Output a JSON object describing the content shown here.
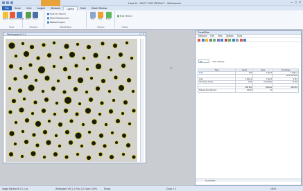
{
  "window": {
    "title": "Heat M - FACT FOR RESULT - Workbench",
    "btn_min": "–",
    "btn_max": "□",
    "btn_close": "×"
  },
  "tabs": [
    "File",
    "Home",
    "View",
    "Acquire",
    "Measure",
    "Layout",
    "Tools",
    "Share Window"
  ],
  "ribbon": {
    "groups": [
      {
        "label": "Tools"
      },
      {
        "label": "Measure"
      },
      {
        "label": "Classification"
      },
      {
        "label": "Options"
      },
      {
        "label": "Output"
      }
    ],
    "buttons": [
      "Select",
      "Measure",
      "Threshold",
      "Refine",
      "Count",
      "Table",
      "Data",
      "Export"
    ],
    "small": [
      "Optimize Objects",
      "Object Measurement",
      "Measure Layout",
      "Data Options"
    ]
  },
  "image_window": {
    "title": "Workspace M 1.1",
    "btns": "– □ ×"
  },
  "panel": {
    "title": "Count/Size",
    "menu": [
      "Measure",
      "Edit",
      "View",
      "Options",
      "Tools"
    ],
    "measure_value": "All",
    "measure_label": "Auto Classify",
    "bottom_tab": "Count/Size",
    "table": {
      "headers": [
        "Type",
        "Count",
        "Area",
        "% of Area"
      ],
      "rows": [
        [
          "Total",
          "761",
          "1.1E+5",
          "1.14E+2"
        ],
        [
          "",
          "",
          "",
          "26.5 px/count"
        ],
        [
          "Area",
          "1.11E+2",
          "1.1E+5",
          "0.112"
        ],
        [
          "Circularity (Cust)",
          "0.81",
          "Circularity",
          "71.0%"
        ],
        [
          "",
          "",
          "",
          ""
        ],
        [
          "",
          "186.261",
          "Objects",
          "186.261"
        ],
        [
          "Filtered Area Percent",
          "89.97",
          "%",
          ""
        ]
      ]
    }
  },
  "status": {
    "left": "Image Window W 1.1  1 px",
    "mid": "Workspace: WS 1.1  Pan: 1.0  Zoom: 100%",
    "mid2": "Ready",
    "right": "Zoom: 1:1",
    "far": "100%"
  },
  "particles": [
    [
      9,
      10,
      4.5
    ],
    [
      25,
      7,
      2
    ],
    [
      38,
      12,
      3
    ],
    [
      55,
      9,
      2.5
    ],
    [
      70,
      6,
      2
    ],
    [
      88,
      11,
      3.5
    ],
    [
      104,
      8,
      2
    ],
    [
      120,
      12,
      3
    ],
    [
      140,
      7,
      2.5
    ],
    [
      158,
      10,
      3
    ],
    [
      175,
      6,
      2
    ],
    [
      15,
      25,
      2
    ],
    [
      30,
      22,
      4
    ],
    [
      47,
      28,
      2.5
    ],
    [
      63,
      24,
      3
    ],
    [
      80,
      27,
      2
    ],
    [
      96,
      23,
      4
    ],
    [
      113,
      28,
      2
    ],
    [
      130,
      24,
      3.5
    ],
    [
      149,
      27,
      2
    ],
    [
      166,
      23,
      3
    ],
    [
      182,
      28,
      2
    ],
    [
      8,
      40,
      3
    ],
    [
      22,
      43,
      2
    ],
    [
      36,
      38,
      2.5
    ],
    [
      52,
      45,
      5
    ],
    [
      70,
      40,
      2
    ],
    [
      86,
      44,
      3
    ],
    [
      102,
      39,
      2.5
    ],
    [
      118,
      44,
      2
    ],
    [
      134,
      40,
      4
    ],
    [
      152,
      45,
      2
    ],
    [
      170,
      39,
      3
    ],
    [
      14,
      58,
      2.5
    ],
    [
      29,
      55,
      3
    ],
    [
      44,
      60,
      2
    ],
    [
      60,
      57,
      3.5
    ],
    [
      76,
      61,
      2
    ],
    [
      92,
      56,
      2.5
    ],
    [
      108,
      60,
      4
    ],
    [
      124,
      57,
      2
    ],
    [
      141,
      61,
      3
    ],
    [
      159,
      56,
      2.5
    ],
    [
      178,
      60,
      3
    ],
    [
      6,
      72,
      2
    ],
    [
      21,
      75,
      3
    ],
    [
      37,
      71,
      4.5
    ],
    [
      54,
      76,
      2
    ],
    [
      69,
      72,
      3
    ],
    [
      85,
      77,
      2.5
    ],
    [
      101,
      73,
      3
    ],
    [
      117,
      77,
      2
    ],
    [
      133,
      72,
      3
    ],
    [
      150,
      76,
      2
    ],
    [
      167,
      71,
      4
    ],
    [
      184,
      76,
      2
    ],
    [
      12,
      90,
      3
    ],
    [
      27,
      87,
      2
    ],
    [
      43,
      92,
      2.5
    ],
    [
      59,
      88,
      3
    ],
    [
      74,
      93,
      2
    ],
    [
      90,
      89,
      5
    ],
    [
      107,
      94,
      2
    ],
    [
      123,
      88,
      3
    ],
    [
      139,
      93,
      2.5
    ],
    [
      156,
      89,
      2
    ],
    [
      173,
      92,
      3
    ],
    [
      7,
      106,
      2.5
    ],
    [
      23,
      103,
      3.5
    ],
    [
      39,
      108,
      2
    ],
    [
      55,
      104,
      3
    ],
    [
      71,
      109,
      2
    ],
    [
      87,
      104,
      3
    ],
    [
      103,
      109,
      2.5
    ],
    [
      119,
      104,
      4
    ],
    [
      136,
      109,
      2
    ],
    [
      152,
      105,
      3
    ],
    [
      169,
      108,
      2
    ],
    [
      185,
      104,
      2.5
    ],
    [
      15,
      121,
      2
    ],
    [
      31,
      118,
      3
    ],
    [
      47,
      123,
      4
    ],
    [
      63,
      119,
      2
    ],
    [
      79,
      124,
      3
    ],
    [
      95,
      119,
      2.5
    ],
    [
      112,
      124,
      2
    ],
    [
      128,
      120,
      3.5
    ],
    [
      145,
      124,
      2
    ],
    [
      162,
      119,
      3
    ],
    [
      179,
      123,
      2
    ],
    [
      9,
      137,
      3.5
    ],
    [
      25,
      134,
      2
    ],
    [
      41,
      139,
      2.5
    ],
    [
      57,
      135,
      3
    ],
    [
      73,
      140,
      2
    ],
    [
      89,
      135,
      3
    ],
    [
      105,
      140,
      4.5
    ],
    [
      121,
      135,
      2
    ],
    [
      138,
      140,
      3
    ],
    [
      154,
      136,
      2
    ],
    [
      171,
      140,
      3
    ],
    [
      14,
      152,
      2
    ],
    [
      30,
      149,
      3
    ],
    [
      46,
      154,
      2.5
    ],
    [
      62,
      150,
      3.5
    ],
    [
      78,
      155,
      2
    ],
    [
      94,
      150,
      3
    ],
    [
      110,
      155,
      2
    ],
    [
      127,
      151,
      3
    ],
    [
      143,
      155,
      2.5
    ],
    [
      160,
      150,
      2
    ],
    [
      177,
      154,
      3
    ],
    [
      8,
      167,
      3
    ],
    [
      24,
      170,
      2
    ],
    [
      40,
      166,
      3.5
    ],
    [
      56,
      171,
      2
    ],
    [
      72,
      167,
      3
    ],
    [
      88,
      171,
      2.5
    ],
    [
      104,
      167,
      2
    ],
    [
      120,
      172,
      3
    ],
    [
      137,
      167,
      2.5
    ],
    [
      153,
      171,
      3
    ],
    [
      170,
      167,
      2
    ],
    [
      185,
      171,
      2.5
    ]
  ]
}
